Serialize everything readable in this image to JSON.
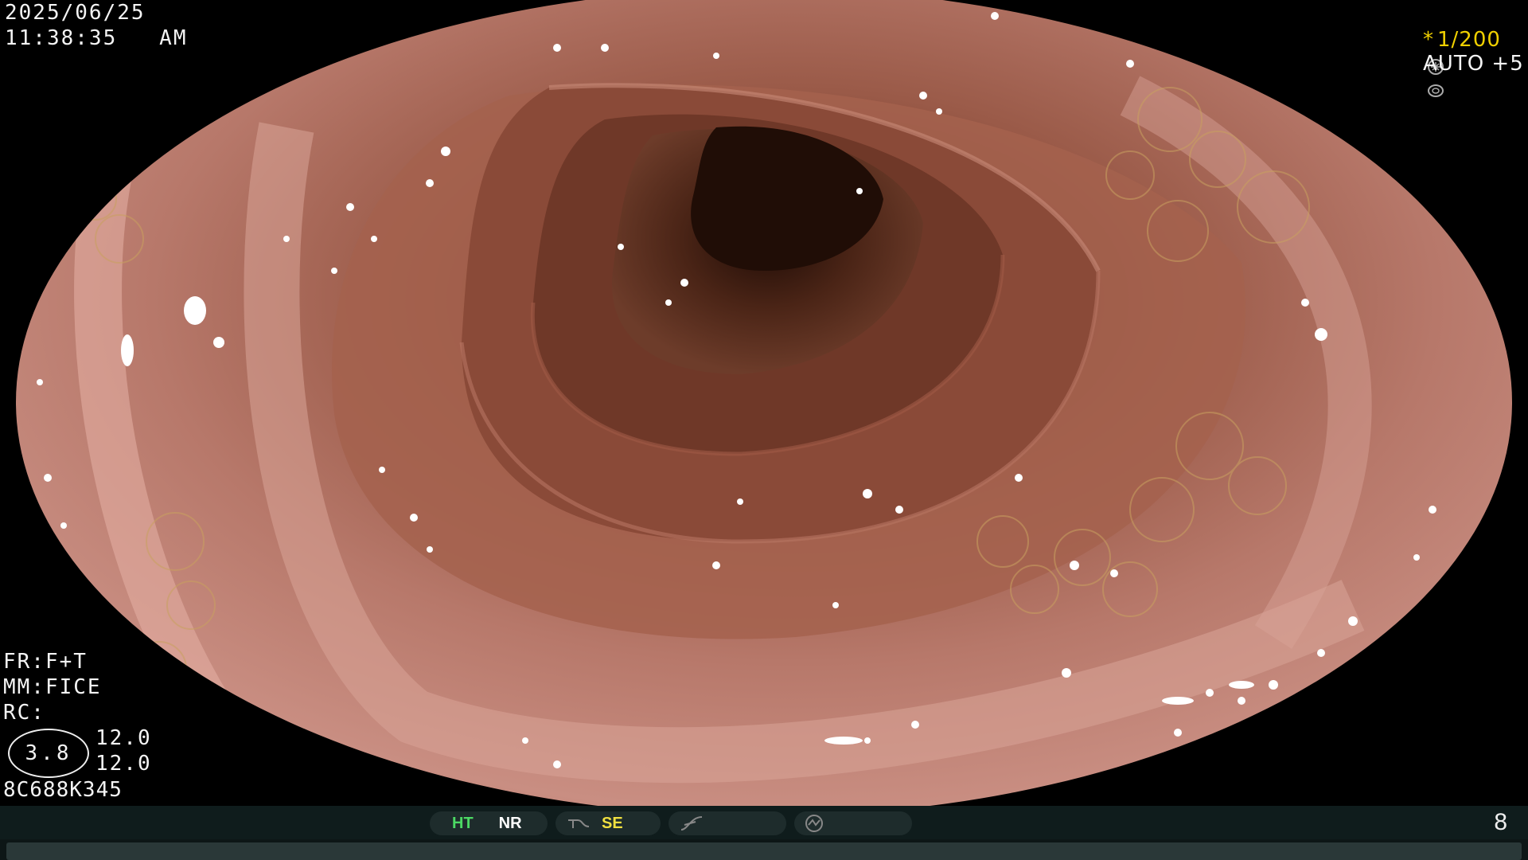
{
  "osd": {
    "date": "2025/06/25",
    "time": "11:38:35   AM",
    "shutter": "1/200",
    "shutter_symbol": "*",
    "exposure": "AUTO +5",
    "fr": "FR:F+T",
    "mm": "MM:FICE",
    "rc": "RC:",
    "ratio": "3.8",
    "value_1": "12.0",
    "value_2": "12.0",
    "device_id": "8C688K345"
  },
  "status_bar": {
    "ht": "HT",
    "nr": "NR",
    "se": "SE",
    "page_number": "8",
    "colors": {
      "ht": "#4cd964",
      "se": "#f0e040",
      "nr": "#ffffff"
    }
  },
  "icons": [
    "iris-icon",
    "ring-icon",
    "structure-enhance-icon",
    "curve-icon",
    "pump-icon"
  ]
}
